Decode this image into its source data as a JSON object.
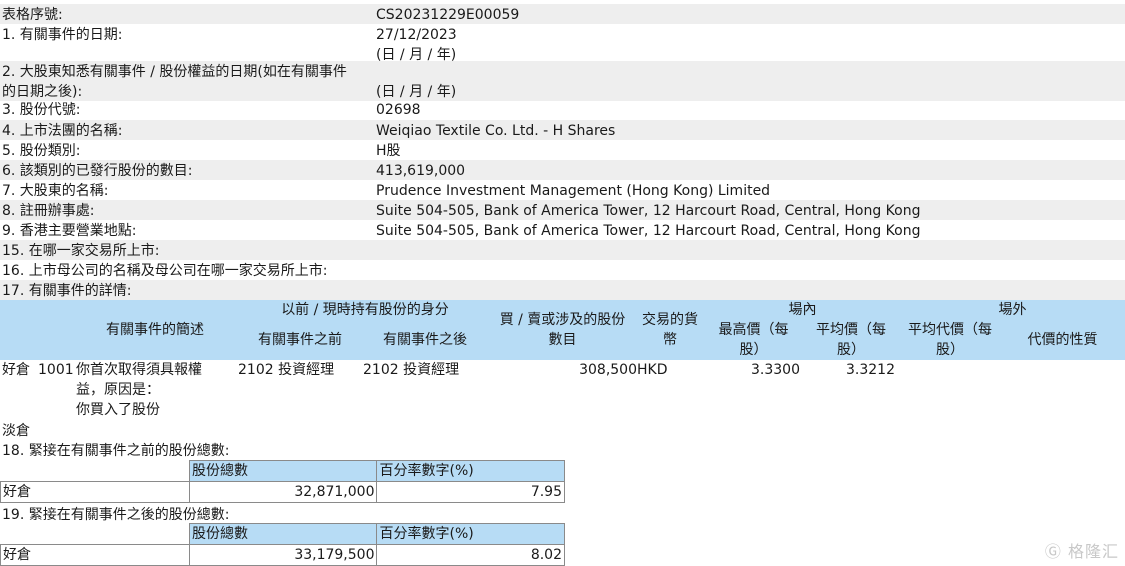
{
  "fields": [
    {
      "label": "表格序號:",
      "value": "CS20231229E00059"
    },
    {
      "label": "1. 有關事件的日期:",
      "value": "27/12/2023",
      "value2": "(日 / 月 / 年)"
    },
    {
      "label": "2. 大股東知悉有關事件 / 股份權益的日期(如在有關事件",
      "label2": "的日期之後):",
      "value2": "(日 / 月 / 年)"
    },
    {
      "label": "3. 股份代號:",
      "value": "02698"
    },
    {
      "label": "4. 上市法團的名稱:",
      "value": "Weiqiao Textile Co. Ltd. - H Shares"
    },
    {
      "label": "5. 股份類別:",
      "value": "H股"
    },
    {
      "label": "6. 該類別的已發行股份的數目:",
      "value": "413,619,000"
    },
    {
      "label": "7. 大股東的名稱:",
      "value": "Prudence Investment Management (Hong Kong) Limited"
    },
    {
      "label": "8. 註冊辦事處:",
      "value": "Suite 504-505, Bank of America Tower, 12 Harcourt Road, Central, Hong Kong"
    },
    {
      "label": "9. 香港主要營業地點:",
      "value": "Suite 504-505, Bank of America Tower, 12 Harcourt Road, Central, Hong Kong"
    },
    {
      "label": "15. 在哪一家交易所上市:"
    },
    {
      "label": "16. 上市母公司的名稱及母公司在哪一家交易所上市:"
    },
    {
      "label": "17. 有關事件的詳情:"
    }
  ],
  "event_table": {
    "headers": {
      "description": "有關事件的簡述",
      "capacity": "以前 / 現時持有股份的身分",
      "before": "有關事件之前",
      "after": "有關事件之後",
      "shares_line1": "買 / 賣或涉及的股份",
      "shares_line2": "數目",
      "currency_line1": "交易的貨",
      "currency_line2": "幣",
      "on_exchange": "場內",
      "off_exchange": "場外",
      "high_line1": "最高價（每",
      "high_line2": "股）",
      "avg_line1": "平均價（每",
      "avg_line2": "股）",
      "off_avg_line1": "平均代價（每",
      "off_avg_line2": "股）",
      "consideration": "代價的性質"
    },
    "long_row": {
      "position": "好倉",
      "code": "1001",
      "description_lines": [
        "你首次取得須具報權",
        "益，原因是：",
        "你買入了股份"
      ],
      "before": "2102 投資經理",
      "after": "2102 投資經理",
      "shares": "308,500",
      "currency": "HKD",
      "high_price": "3.3300",
      "avg_price": "3.3212"
    },
    "short_label": "淡倉"
  },
  "section18": {
    "title": "18. 緊接在有關事件之前的股份總數:",
    "col_shares": "股份總數",
    "col_percent": "百分率數字(%)",
    "row_label": "好倉",
    "shares": "32,871,000",
    "percent": "7.95"
  },
  "section19": {
    "title": "19. 緊接在有關事件之後的股份總數:",
    "col_shares": "股份總數",
    "col_percent": "百分率數字(%)",
    "row_label": "好倉",
    "shares": "33,179,500",
    "percent": "8.02"
  },
  "watermark": "格隆汇"
}
